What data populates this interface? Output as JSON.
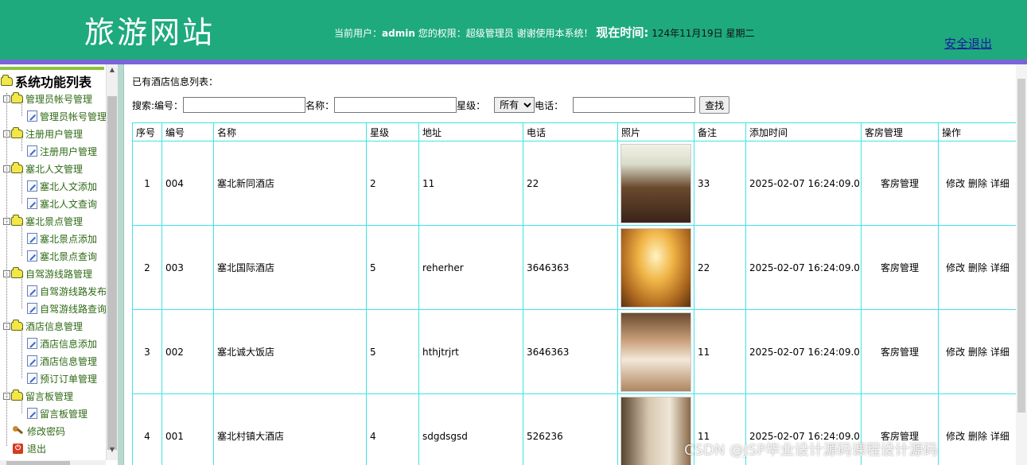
{
  "header": {
    "site_title": "旅游网站",
    "user_prefix": "当前用户：",
    "username": "admin",
    "permission_prefix": " 您的权限：",
    "permission": "超级管理员",
    "thanks": " 谢谢使用本系统！",
    "time_label": "现在时间:",
    "time_value": " 124年11月19日 星期二",
    "logout": "安全退出"
  },
  "sidebar": {
    "root": "系统功能列表",
    "groups": [
      {
        "label": "管理员帐号管理",
        "items": [
          "管理员帐号管理"
        ]
      },
      {
        "label": "注册用户管理",
        "items": [
          "注册用户管理"
        ]
      },
      {
        "label": "塞北人文管理",
        "items": [
          "塞北人文添加",
          "塞北人文查询"
        ]
      },
      {
        "label": "塞北景点管理",
        "items": [
          "塞北景点添加",
          "塞北景点查询"
        ]
      },
      {
        "label": "自驾游线路管理",
        "items": [
          "自驾游线路发布",
          "自驾游线路查询"
        ]
      },
      {
        "label": "酒店信息管理",
        "items": [
          "酒店信息添加",
          "酒店信息管理",
          "预订订单管理"
        ]
      },
      {
        "label": "留言板管理",
        "items": [
          "留言板管理"
        ]
      }
    ],
    "change_password": "修改密码",
    "exit": "退出"
  },
  "main": {
    "caption": "已有酒店信息列表：",
    "search": {
      "label": "搜索:",
      "code_label": " 编号：",
      "code_value": "",
      "name_label": " 名称：",
      "name_value": "",
      "star_label": "星级：",
      "star_selected": "所有",
      "phone_label": " 电话：",
      "phone_value": "",
      "button": "查找"
    },
    "table": {
      "headers": [
        "序号",
        "编号",
        "名称",
        "星级",
        "地址",
        "电话",
        "照片",
        "备注",
        "添加时间",
        "客房管理",
        "操作"
      ],
      "rows": [
        {
          "index": "1",
          "code": "004",
          "name": "塞北新同酒店",
          "star": "2",
          "address": "11",
          "phone": "22",
          "note": "33",
          "added": "2025-02-07 16:24:09.0",
          "room": "客房管理"
        },
        {
          "index": "2",
          "code": "003",
          "name": "塞北国际酒店",
          "star": "5",
          "address": "reherher",
          "phone": "3646363",
          "note": "22",
          "added": "2025-02-07 16:24:09.0",
          "room": "客房管理"
        },
        {
          "index": "3",
          "code": "002",
          "name": "塞北诚大饭店",
          "star": "5",
          "address": "hthjtrjrt",
          "phone": "3646363",
          "note": "11",
          "added": "2025-02-07 16:24:09.0",
          "room": "客房管理"
        },
        {
          "index": "4",
          "code": "001",
          "name": "塞北村镇大酒店",
          "star": "4",
          "address": "sdgdsgsd",
          "phone": "526236",
          "note": "11",
          "added": "2025-02-07 16:24:09.0",
          "room": "客房管理"
        }
      ],
      "actions": {
        "edit": "修改",
        "delete": "删除",
        "detail": "详细"
      }
    }
  },
  "watermark": "CSDN @JSP毕业设计源码课程设计源码",
  "colors": {
    "header_bg": "#1eaa7c",
    "header_stripe": "#7a64d8",
    "table_border": "#3fe3e6",
    "sidebar_text": "#2f6a16"
  }
}
